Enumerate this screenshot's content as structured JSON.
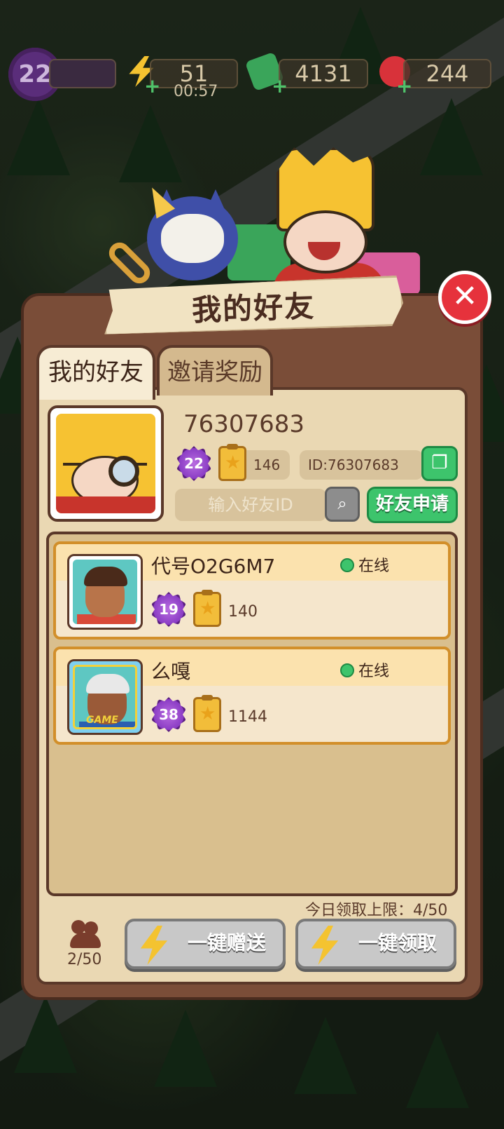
{
  "hud": {
    "level": "22",
    "energy": "51",
    "energy_timer": "00:57",
    "cash": "4131",
    "gems": "244"
  },
  "dialog": {
    "title": "我的好友",
    "close_icon": "close-x-icon"
  },
  "tabs": [
    {
      "label": "我的好友",
      "active": true
    },
    {
      "label": "邀请奖励",
      "active": false
    }
  ],
  "profile": {
    "name": "76307683",
    "level": "22",
    "stars": "146",
    "id_text": "ID:76307683",
    "copy_icon": "copy-icon"
  },
  "search": {
    "placeholder": "输入好友ID",
    "search_icon": "search-icon",
    "apply_label": "好友申请"
  },
  "friends": [
    {
      "name": "代号O2G6M7",
      "status": "在线",
      "level": "19",
      "stars": "140"
    },
    {
      "name": "么嘎",
      "status": "在线",
      "level": "38",
      "stars": "1144",
      "frame_tag": "GAME"
    }
  ],
  "footer": {
    "limit_text": "今日领取上限：4/50",
    "friend_count": "2/50",
    "send_all_label": "一键赠送",
    "claim_all_label": "一键领取"
  },
  "colors": {
    "panel": "#7a4d38",
    "inner": "#ead8b3",
    "accent_green": "#3dc46c",
    "close_red": "#e6323c",
    "online_green": "#3dc46c"
  }
}
